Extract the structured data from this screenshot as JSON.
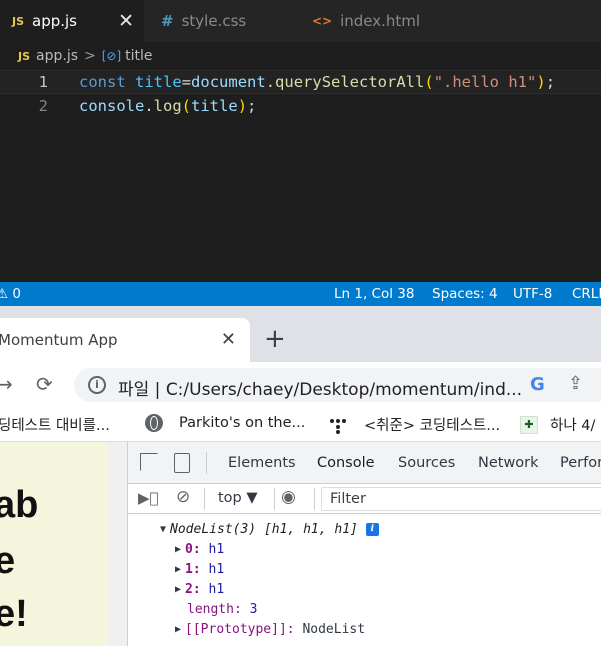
{
  "editor": {
    "tabs": [
      {
        "icon": "JS",
        "label": "app.js",
        "active": true
      },
      {
        "icon": "#",
        "label": "style.css",
        "active": false
      },
      {
        "icon": "<>",
        "label": "index.html",
        "active": false
      }
    ],
    "close_glyph": "✕",
    "breadcrumb": {
      "file_icon": "JS",
      "file": "app.js",
      "separator": ">",
      "symbol_icon": "[⊘]",
      "symbol": "title"
    },
    "lines": [
      {
        "number": "1",
        "tokens": {
          "kw": "const",
          "var": "title",
          "eq": "=",
          "obj": "document",
          "dot": ".",
          "fn": "querySelectorAll",
          "open": "(",
          "str": "\".hello h1\"",
          "close": ")",
          "semi": ";"
        }
      },
      {
        "number": "2",
        "tokens": {
          "obj": "console",
          "dot": ".",
          "fn": "log",
          "open": "(",
          "var": "title",
          "close": ")",
          "semi": ";"
        }
      }
    ],
    "status": {
      "warnings": "⚠ 0",
      "position": "Ln 1, Col 38",
      "spaces": "Spaces: 4",
      "encoding": "UTF-8",
      "eol": "CRLF"
    }
  },
  "browser": {
    "tab_title": "Momentum App",
    "tab_close": "✕",
    "new_tab": "+",
    "nav": {
      "forward": "→",
      "reload": "⟳"
    },
    "address": {
      "info": "i",
      "text": "파일 | C:/Users/chaey/Desktop/momentum/ind...",
      "google": "G",
      "share": "⇪"
    },
    "bookmarks": [
      {
        "label": "딩테스트 대비를..."
      },
      {
        "label": "Parkito's on the..."
      },
      {
        "label": "<취준> 코딩테스트..."
      },
      {
        "label": "하나 4/"
      }
    ],
    "page_lines": [
      "ab",
      "e",
      "e!"
    ]
  },
  "devtools": {
    "tabs": [
      "Elements",
      "Console",
      "Sources",
      "Network",
      "Perfor"
    ],
    "active_tab": "Console",
    "context": "top ▼",
    "filter_placeholder": "Filter",
    "console": {
      "summary": "NodeList(3) [h1, h1, h1]",
      "info_badge": "i",
      "items": [
        {
          "key": "0",
          "value": "h1"
        },
        {
          "key": "1",
          "value": "h1"
        },
        {
          "key": "2",
          "value": "h1"
        }
      ],
      "length_key": "length",
      "length_value": "3",
      "proto_key": "[[Prototype]]",
      "proto_value": "NodeList"
    }
  },
  "colors": {
    "status_bar": "#007acc",
    "page_bg": "#f5f4dc",
    "active_tab_underline": "#1a73e8"
  }
}
